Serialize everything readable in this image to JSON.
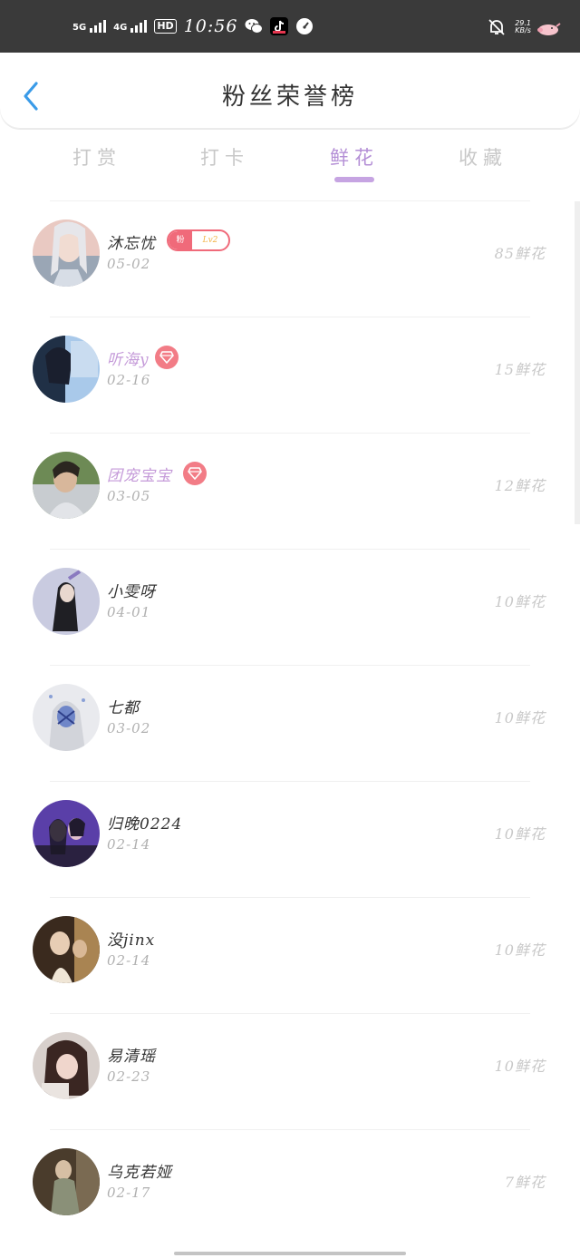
{
  "status_bar": {
    "net1": "5G",
    "net2": "4G",
    "hd": "HD",
    "time": "10:56",
    "speed_value": "29.1",
    "speed_unit": "KB/s"
  },
  "header": {
    "title": "粉丝荣誉榜",
    "back_icon": "chevron-left-icon"
  },
  "tabs": [
    {
      "label": "打赏",
      "active": false
    },
    {
      "label": "打卡",
      "active": false
    },
    {
      "label": "鲜花",
      "active": true
    },
    {
      "label": "收藏",
      "active": false
    }
  ],
  "fans": [
    {
      "name": "沐忘忧",
      "date": "05-02",
      "count": "85鲜花",
      "badge": "fan",
      "badge_left": "粉",
      "badge_right": "Lv2"
    },
    {
      "name": "听海y",
      "date": "02-16",
      "count": "15鲜花",
      "badge": "vip"
    },
    {
      "name": "团宠宝宝",
      "date": "03-05",
      "count": "12鲜花",
      "badge": "vip"
    },
    {
      "name": "小雯呀",
      "date": "04-01",
      "count": "10鲜花",
      "badge": "none"
    },
    {
      "name": "七都",
      "date": "03-02",
      "count": "10鲜花",
      "badge": "none"
    },
    {
      "name": "归晚0224",
      "date": "02-14",
      "count": "10鲜花",
      "badge": "none"
    },
    {
      "name": "没jinx",
      "date": "02-14",
      "count": "10鲜花",
      "badge": "none"
    },
    {
      "name": "易清瑶",
      "date": "02-23",
      "count": "10鲜花",
      "badge": "none"
    },
    {
      "name": "乌克若娅",
      "date": "02-17",
      "count": "7鲜花",
      "badge": "none"
    }
  ],
  "colors": {
    "accent": "#b48fd6",
    "vip_name": "#c59bd9",
    "badge": "#f27c86",
    "back_arrow": "#3a9be8"
  }
}
